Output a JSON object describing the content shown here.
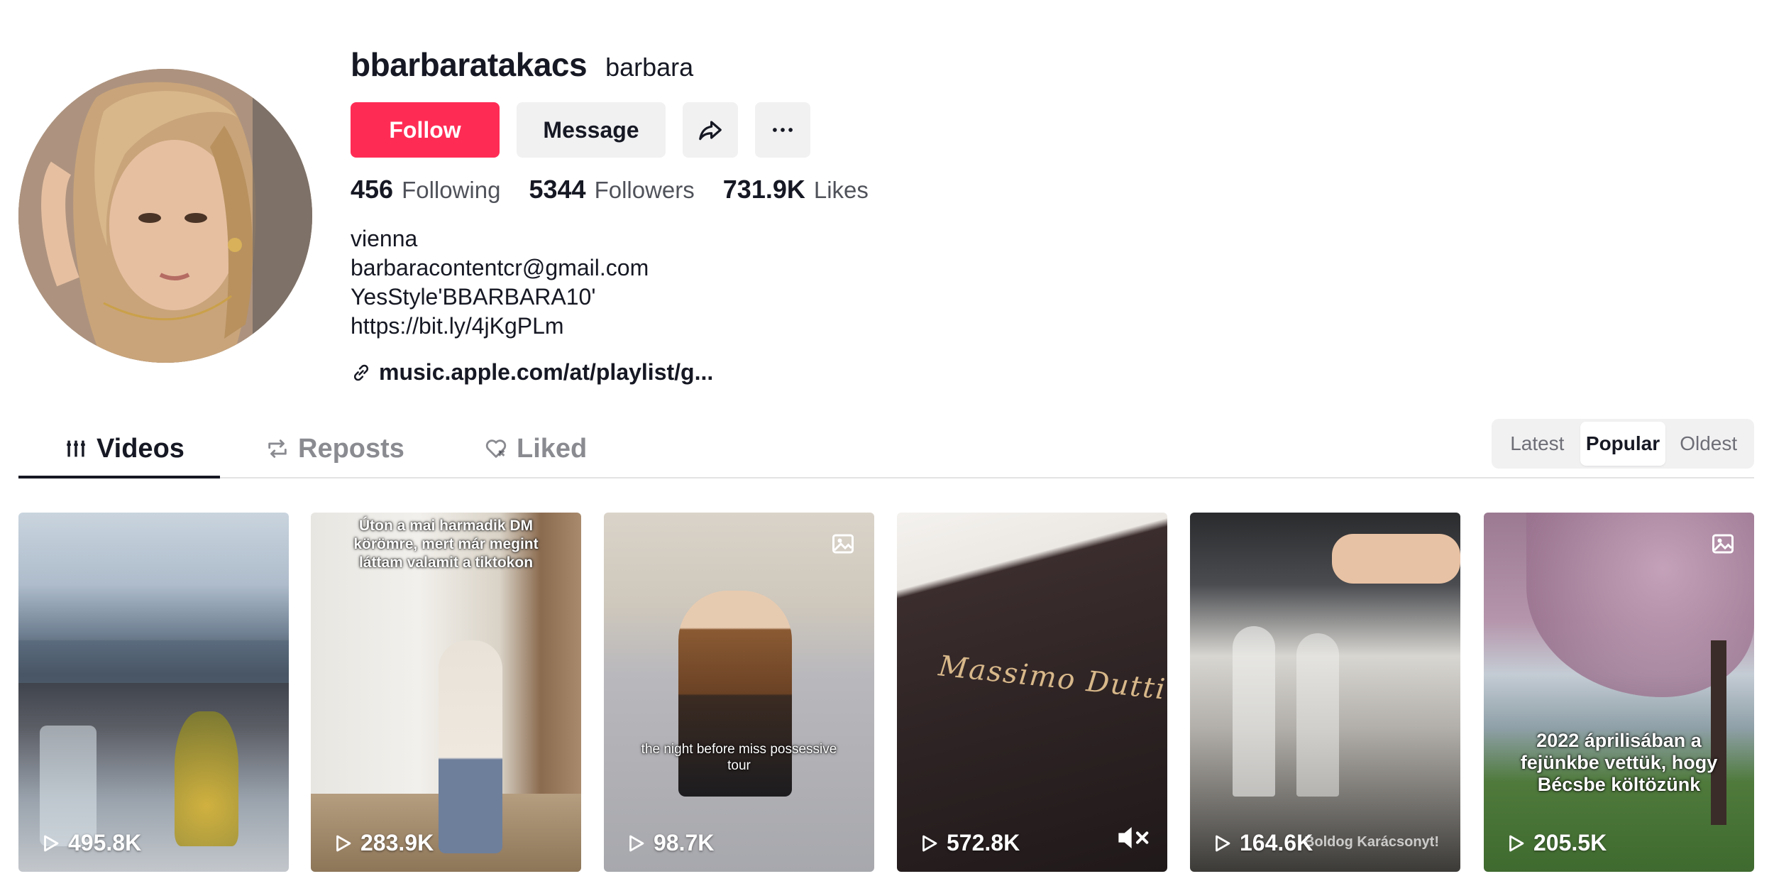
{
  "profile": {
    "username": "bbarbaratakacs",
    "nickname": "barbara",
    "buttons": {
      "follow": "Follow",
      "message": "Message"
    },
    "stats": [
      {
        "value": "456",
        "label": "Following"
      },
      {
        "value": "5344",
        "label": "Followers"
      },
      {
        "value": "731.9K",
        "label": "Likes"
      }
    ],
    "bio": [
      "vienna",
      "barbaracontentcr@gmail.com",
      "YesStyle'BBARBARA10'",
      "https://bit.ly/4jKgPLm"
    ],
    "link": "music.apple.com/at/playlist/g..."
  },
  "tabs": [
    {
      "label": "Videos",
      "icon": "grid-icon",
      "active": true
    },
    {
      "label": "Reposts",
      "icon": "repost-icon",
      "active": false
    },
    {
      "label": "Liked",
      "icon": "liked-heart-icon",
      "active": false
    }
  ],
  "sort": {
    "options": [
      "Latest",
      "Popular",
      "Oldest"
    ],
    "selected": "Popular"
  },
  "videos": [
    {
      "views": "495.8K",
      "caption": ""
    },
    {
      "views": "283.9K",
      "caption": "Úton a mai harmadik DM körömre, mert már megint láttam valamit a tiktokon"
    },
    {
      "views": "98.7K",
      "caption": "the night before miss possessive tour"
    },
    {
      "views": "572.8K",
      "caption": "",
      "brand": "Massimo Dutti"
    },
    {
      "views": "164.6K",
      "caption": "",
      "corner": "Boldog Karácsonyt!"
    },
    {
      "views": "205.5K",
      "caption": "2022 áprilisában a fejünkbe vettük, hogy Bécsbe költözünk"
    }
  ],
  "colors": {
    "accent": "#fe2c55",
    "text": "#161823",
    "button_bg": "#f1f1f2"
  }
}
